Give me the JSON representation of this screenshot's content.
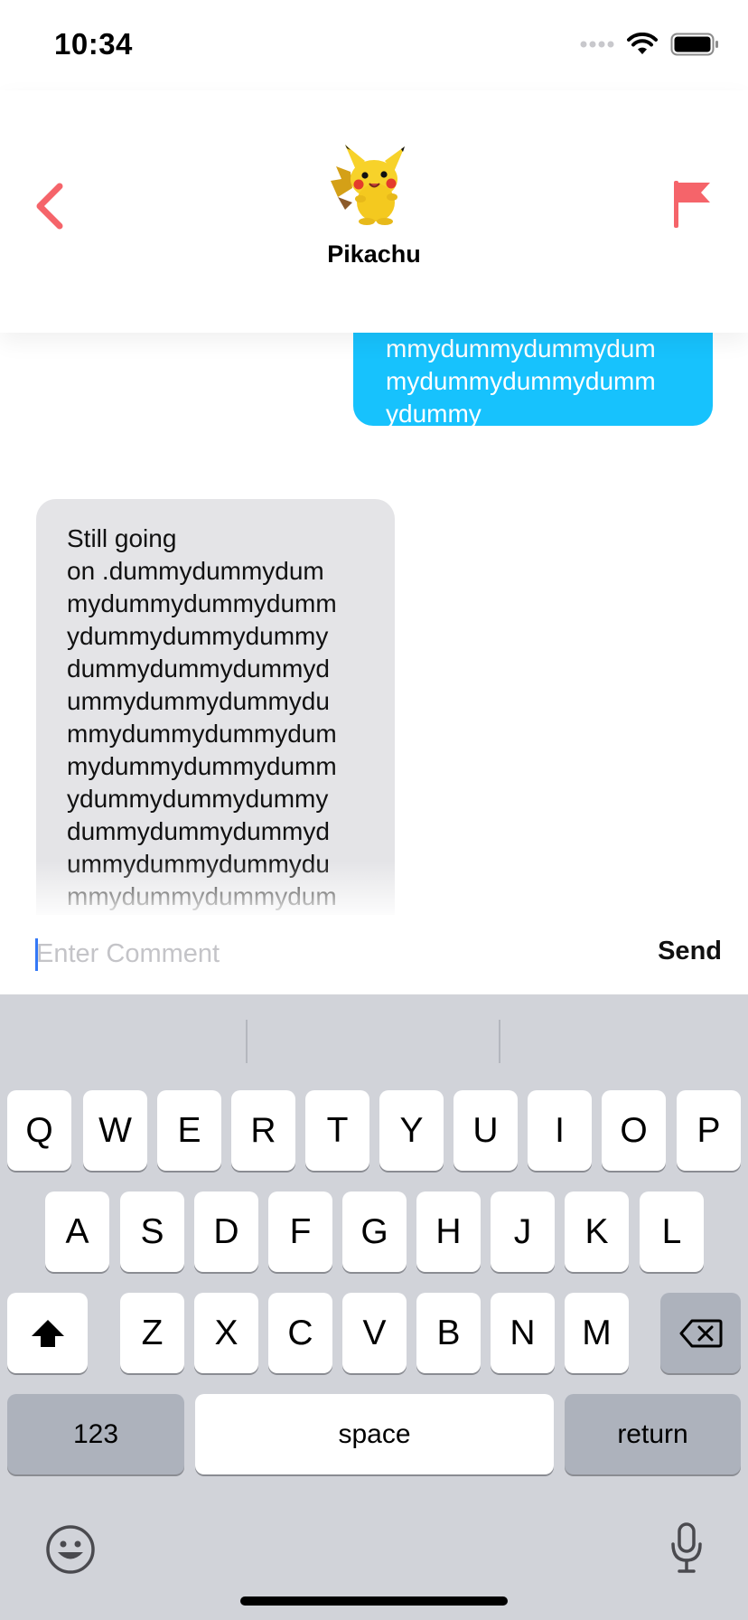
{
  "status_bar": {
    "time": "10:34"
  },
  "header": {
    "contact_name": "Pikachu"
  },
  "messages": [
    {
      "from": "me",
      "text": "mmydummydummydum\nmydummydummydumm\nydummy"
    },
    {
      "from": "them",
      "text": "Still going\non .dummydummydum\nmydummydummydumm\nydummydummydummy\ndummydummydummyd\nummydummydummydu\nmmydummydummydum\nmydummydummydumm\nydummydummydummy\ndummydummydummyd\nummydummydummydu\nmmydummydummydum"
    }
  ],
  "comment": {
    "placeholder": "Enter Comment",
    "value": "",
    "send_label": "Send"
  },
  "keyboard": {
    "row1": [
      "Q",
      "W",
      "E",
      "R",
      "T",
      "Y",
      "U",
      "I",
      "O",
      "P"
    ],
    "row2": [
      "A",
      "S",
      "D",
      "F",
      "G",
      "H",
      "J",
      "K",
      "L"
    ],
    "row3": [
      "Z",
      "X",
      "C",
      "V",
      "B",
      "N",
      "M"
    ],
    "numbers_label": "123",
    "space_label": "space",
    "return_label": "return"
  },
  "colors": {
    "accent": "#f5646a",
    "outgoing_bubble": "#17c2fd",
    "incoming_bubble": "#e4e4e7"
  },
  "icons": [
    "back-chevron-icon",
    "flag-icon",
    "shift-icon",
    "backspace-icon",
    "emoji-icon",
    "microphone-icon"
  ]
}
